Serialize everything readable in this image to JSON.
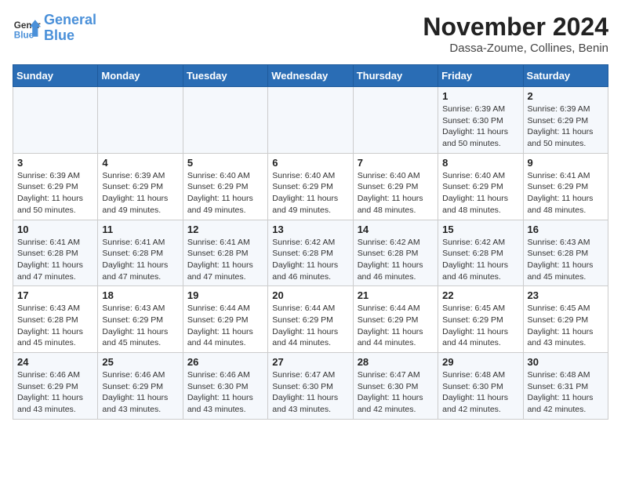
{
  "header": {
    "logo_line1": "General",
    "logo_line2": "Blue",
    "month_title": "November 2024",
    "subtitle": "Dassa-Zoume, Collines, Benin"
  },
  "weekdays": [
    "Sunday",
    "Monday",
    "Tuesday",
    "Wednesday",
    "Thursday",
    "Friday",
    "Saturday"
  ],
  "weeks": [
    [
      {
        "day": "",
        "info": ""
      },
      {
        "day": "",
        "info": ""
      },
      {
        "day": "",
        "info": ""
      },
      {
        "day": "",
        "info": ""
      },
      {
        "day": "",
        "info": ""
      },
      {
        "day": "1",
        "info": "Sunrise: 6:39 AM\nSunset: 6:30 PM\nDaylight: 11 hours and 50 minutes."
      },
      {
        "day": "2",
        "info": "Sunrise: 6:39 AM\nSunset: 6:29 PM\nDaylight: 11 hours and 50 minutes."
      }
    ],
    [
      {
        "day": "3",
        "info": "Sunrise: 6:39 AM\nSunset: 6:29 PM\nDaylight: 11 hours and 50 minutes."
      },
      {
        "day": "4",
        "info": "Sunrise: 6:39 AM\nSunset: 6:29 PM\nDaylight: 11 hours and 49 minutes."
      },
      {
        "day": "5",
        "info": "Sunrise: 6:40 AM\nSunset: 6:29 PM\nDaylight: 11 hours and 49 minutes."
      },
      {
        "day": "6",
        "info": "Sunrise: 6:40 AM\nSunset: 6:29 PM\nDaylight: 11 hours and 49 minutes."
      },
      {
        "day": "7",
        "info": "Sunrise: 6:40 AM\nSunset: 6:29 PM\nDaylight: 11 hours and 48 minutes."
      },
      {
        "day": "8",
        "info": "Sunrise: 6:40 AM\nSunset: 6:29 PM\nDaylight: 11 hours and 48 minutes."
      },
      {
        "day": "9",
        "info": "Sunrise: 6:41 AM\nSunset: 6:29 PM\nDaylight: 11 hours and 48 minutes."
      }
    ],
    [
      {
        "day": "10",
        "info": "Sunrise: 6:41 AM\nSunset: 6:28 PM\nDaylight: 11 hours and 47 minutes."
      },
      {
        "day": "11",
        "info": "Sunrise: 6:41 AM\nSunset: 6:28 PM\nDaylight: 11 hours and 47 minutes."
      },
      {
        "day": "12",
        "info": "Sunrise: 6:41 AM\nSunset: 6:28 PM\nDaylight: 11 hours and 47 minutes."
      },
      {
        "day": "13",
        "info": "Sunrise: 6:42 AM\nSunset: 6:28 PM\nDaylight: 11 hours and 46 minutes."
      },
      {
        "day": "14",
        "info": "Sunrise: 6:42 AM\nSunset: 6:28 PM\nDaylight: 11 hours and 46 minutes."
      },
      {
        "day": "15",
        "info": "Sunrise: 6:42 AM\nSunset: 6:28 PM\nDaylight: 11 hours and 46 minutes."
      },
      {
        "day": "16",
        "info": "Sunrise: 6:43 AM\nSunset: 6:28 PM\nDaylight: 11 hours and 45 minutes."
      }
    ],
    [
      {
        "day": "17",
        "info": "Sunrise: 6:43 AM\nSunset: 6:28 PM\nDaylight: 11 hours and 45 minutes."
      },
      {
        "day": "18",
        "info": "Sunrise: 6:43 AM\nSunset: 6:29 PM\nDaylight: 11 hours and 45 minutes."
      },
      {
        "day": "19",
        "info": "Sunrise: 6:44 AM\nSunset: 6:29 PM\nDaylight: 11 hours and 44 minutes."
      },
      {
        "day": "20",
        "info": "Sunrise: 6:44 AM\nSunset: 6:29 PM\nDaylight: 11 hours and 44 minutes."
      },
      {
        "day": "21",
        "info": "Sunrise: 6:44 AM\nSunset: 6:29 PM\nDaylight: 11 hours and 44 minutes."
      },
      {
        "day": "22",
        "info": "Sunrise: 6:45 AM\nSunset: 6:29 PM\nDaylight: 11 hours and 44 minutes."
      },
      {
        "day": "23",
        "info": "Sunrise: 6:45 AM\nSunset: 6:29 PM\nDaylight: 11 hours and 43 minutes."
      }
    ],
    [
      {
        "day": "24",
        "info": "Sunrise: 6:46 AM\nSunset: 6:29 PM\nDaylight: 11 hours and 43 minutes."
      },
      {
        "day": "25",
        "info": "Sunrise: 6:46 AM\nSunset: 6:29 PM\nDaylight: 11 hours and 43 minutes."
      },
      {
        "day": "26",
        "info": "Sunrise: 6:46 AM\nSunset: 6:30 PM\nDaylight: 11 hours and 43 minutes."
      },
      {
        "day": "27",
        "info": "Sunrise: 6:47 AM\nSunset: 6:30 PM\nDaylight: 11 hours and 43 minutes."
      },
      {
        "day": "28",
        "info": "Sunrise: 6:47 AM\nSunset: 6:30 PM\nDaylight: 11 hours and 42 minutes."
      },
      {
        "day": "29",
        "info": "Sunrise: 6:48 AM\nSunset: 6:30 PM\nDaylight: 11 hours and 42 minutes."
      },
      {
        "day": "30",
        "info": "Sunrise: 6:48 AM\nSunset: 6:31 PM\nDaylight: 11 hours and 42 minutes."
      }
    ]
  ]
}
